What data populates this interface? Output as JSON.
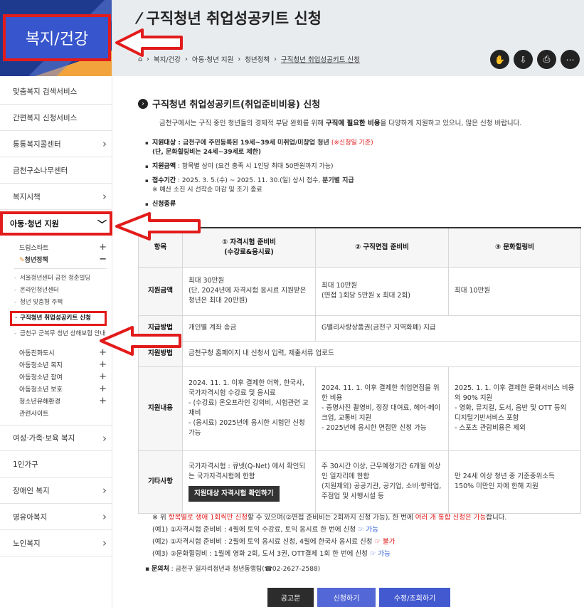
{
  "sidebar": {
    "title": "복지/건강",
    "items_top": [
      "맞춤복지 검색서비스",
      "간편복지 신청서비스",
      "통통복지콜센터",
      "금천구소나무센터",
      "복지시책"
    ],
    "active": "아동·청년 지원",
    "sub": [
      {
        "label": "드림스타트",
        "open": false
      },
      {
        "label": "청년정책",
        "open": true
      }
    ],
    "third": [
      "서울청년센터 금천 청춘빌딩",
      "온라인청년센터",
      "청년 맞춤형 주택",
      "구직청년 취업성공키트 신청",
      "금천구 군복무 청년 상해보험 안내"
    ],
    "sub2": [
      "아동친화도시",
      "아동청소년 복지",
      "아동청소년 참여",
      "아동청소년 보호",
      "청소년유해환경",
      "관련사이트"
    ],
    "items_bottom": [
      "여성·가족·보육 복지",
      "1인가구",
      "장애인 복지",
      "영유아복지",
      "노인복지"
    ]
  },
  "hero": {
    "title": "구직청년 취업성공키트 신청"
  },
  "breadcrumb": [
    "복지/건강",
    "아동·청년 지원",
    "청년정책",
    "구직청년 취업성공키트 신청"
  ],
  "content": {
    "heading": "구직청년 취업성공키트(취업준비비용) 신청",
    "intro_a": "금천구에서는 구직 중인 청년들의 경제적 부담 완화를 위해 ",
    "intro_b": "구직에 필요한 비용",
    "intro_c": "을 다양하게 지원하고 있으니, 많은 신청 바랍니다.",
    "target_label": "지원대상",
    "target_text": " : 금천구에 주민등록된 19세~39세 미취업/미창업 청년 ",
    "target_red": "(※신청일 기준)",
    "target_text2": "(단, 문화힐링비는 24세~39세로 제한)",
    "amount_label": "지원금액",
    "amount_text": " : 항목별 상이 (요건 충족 시 1인당 최대 50만원까지 가능)",
    "period_label": "접수기간",
    "period_text": " : 2025. 3. 5.(수) ~ 2025. 11. 30.(일) 상시 접수, ",
    "period_bold": "분기별 지급",
    "period_note": "※ 예산 소진 시 선착순 마감 및 조기 종료",
    "kind_label": "신청종류"
  },
  "table": {
    "headers": [
      "항목",
      "① 자격시험 준비비\n(수강료&응시료)",
      "② 구직면접 준비비",
      "③ 문화힐링비"
    ],
    "rows": [
      {
        "label": "지원금액",
        "c1": "최대 30만원\n(단, 2024년에 자격시험 응시료 지원받은 청년은 최대 20만원)",
        "c2": "최대 10만원\n(면접 1회당 5만원 x 최대 2회)",
        "c3": "최대 10만원"
      },
      {
        "label": "지급방법",
        "c1": "개인별 계좌 송금",
        "c23": "G밸리사랑상품권(금천구 지역화폐) 지급"
      },
      {
        "label": "지원방법",
        "c123": "금천구청 홈페이지 내 신청서 입력, 제출서류 업로드"
      },
      {
        "label": "지원내용",
        "c1": "2024. 11. 1. 이후 결제한 어학, 한국사, 국가자격시험 수강료 및 응시료\n- (수강료) 온오프라인 강의비, 시험관련 교재비\n- (응시료) 2025년에 응시한 시험만 신청 가능",
        "c2": "2024. 11. 1. 이후 결제한 취업면접을 위한 비용\n- 증명사진 촬영비, 정장 대여료, 헤어·메이크업, 교통비 지원\n- 2025년에 응시한 면접만 신청 가능",
        "c3": "2025. 1. 1. 이후 결제한 문화서비스 비용의 90% 지원\n- 영화, 뮤지컬, 도서, 음반 및 OTT 등의 디지털기반서비스 포함\n- 스포츠 관람비용은 제외"
      },
      {
        "label": "기타사항",
        "c1": "국가자격시험 : 큐넷(Q-Net) 에서 확인되는 국가자격시험에 한함",
        "c1_button": "지원대상 자격시험 확인하기",
        "c2": "주 30시간 이상, 근무예정기간 6개월 이상인 일자리에 한함\n(지원제외) 공공기관, 공기업, 소비·향락업, 주점업 및 사행시설 등",
        "c3": "만 24세 이상 청년 중 기준중위소득 150% 미만인 자에 한해 지원"
      }
    ]
  },
  "notes": {
    "n0a": "※ 위 ",
    "n0b": "항목별로 생애 1회씩만 신청",
    "n0c": "할 수 있으며(②면접 준비비는 2회까지 신청 가능), 한 번에 ",
    "n0d": "여러 개 통합 신청은 가능",
    "n0e": "합니다.",
    "n1": "(예1) ①자격시험 준비비 : 4월에 토익 수강료, 토익 응시료 한 번에 신청 ",
    "n1s": "☞ 가능",
    "n2": "(예2) ①자격시험 준비비 : 2월에 토익 응시료 신청, 4월에 한국사 응시료 신청 ",
    "n2s": "☞ 불가",
    "n3": "(예3) ③문화힐링비 : 1월에 영화 2회, 도서 3권, OTT결제 1회 한 번에 신청 ",
    "n3s": "☞ 가능"
  },
  "contact": {
    "label": "문의처",
    "text": " : 금천구 일자리청년과 청년동행팀(☎02-2627-2588)"
  },
  "buttons": [
    "공고문",
    "신청하기",
    "수정/조회하기"
  ]
}
